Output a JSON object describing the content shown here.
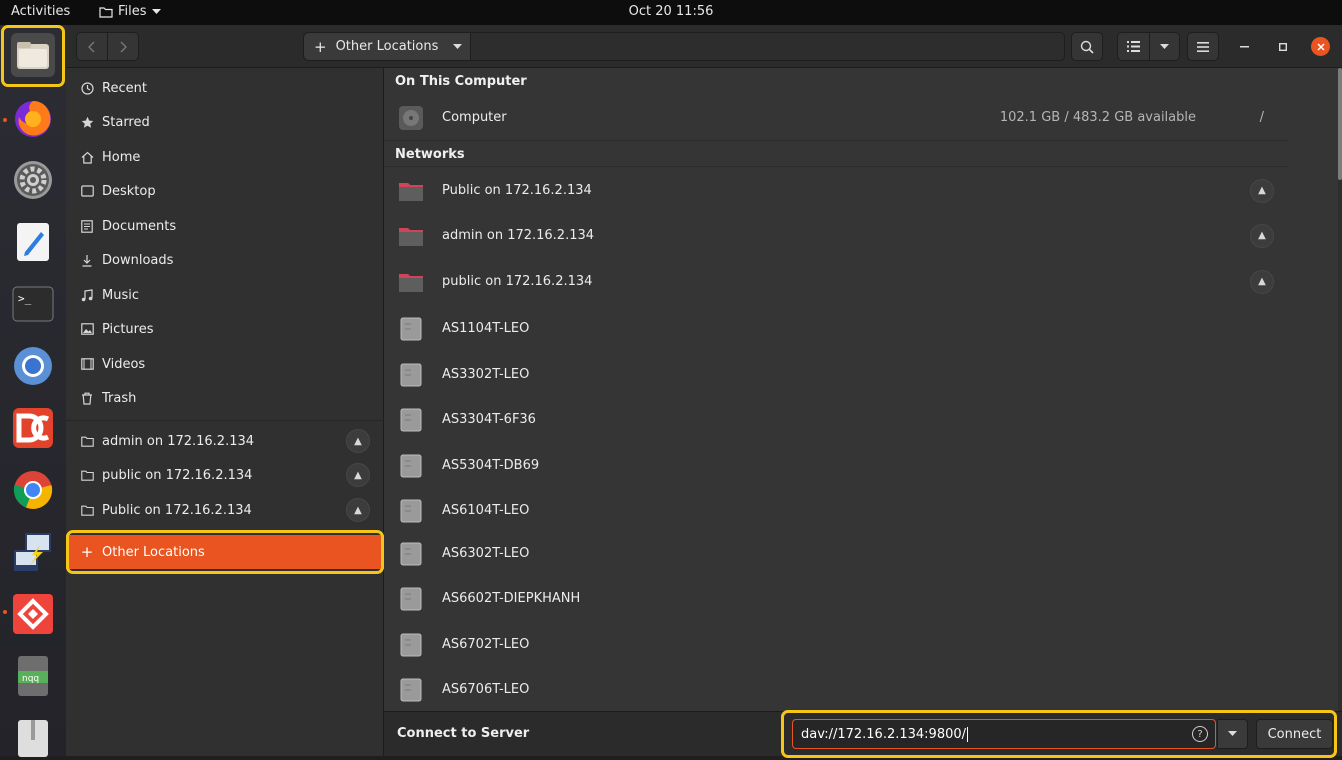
{
  "topbar": {
    "activities": "Activities",
    "app_name": "Files",
    "clock": "Oct 20  11:56"
  },
  "dock": {
    "items": [
      "files-icon",
      "firefox-icon",
      "settings-icon",
      "text-editor-icon",
      "terminal-icon",
      "chromium-icon",
      "doublecommander-icon",
      "chrome-icon",
      "network-connect-icon",
      "anydesk-icon",
      "notes-icon",
      "archive-icon"
    ]
  },
  "header": {
    "location_label": "Other Locations",
    "add_symbol": "+"
  },
  "sidebar": {
    "places": [
      {
        "label": "Recent",
        "icon": "clock-icon"
      },
      {
        "label": "Starred",
        "icon": "star-icon"
      },
      {
        "label": "Home",
        "icon": "home-icon"
      },
      {
        "label": "Desktop",
        "icon": "desktop-icon"
      },
      {
        "label": "Documents",
        "icon": "documents-icon"
      },
      {
        "label": "Downloads",
        "icon": "downloads-icon"
      },
      {
        "label": "Music",
        "icon": "music-icon"
      },
      {
        "label": "Pictures",
        "icon": "pictures-icon"
      },
      {
        "label": "Videos",
        "icon": "videos-icon"
      },
      {
        "label": "Trash",
        "icon": "trash-icon"
      }
    ],
    "mounts": [
      {
        "label": "admin on 172.16.2.134"
      },
      {
        "label": "public on 172.16.2.134"
      },
      {
        "label": "Public on 172.16.2.134"
      }
    ],
    "other_locations": "Other Locations"
  },
  "main": {
    "on_this_computer": "On This Computer",
    "computer": {
      "label": "Computer",
      "info": "102.1 GB / 483.2 GB available",
      "path": "/"
    },
    "networks": "Networks",
    "network_mounts": [
      {
        "label": "Public on 172.16.2.134"
      },
      {
        "label": "admin on 172.16.2.134"
      },
      {
        "label": "public on 172.16.2.134"
      }
    ],
    "network_hosts": [
      {
        "label": "AS1104T-LEO"
      },
      {
        "label": "AS3302T-LEO"
      },
      {
        "label": "AS3304T-6F36"
      },
      {
        "label": "AS5304T-DB69"
      },
      {
        "label": "AS6104T-LEO"
      },
      {
        "label": "AS6302T-LEO"
      },
      {
        "label": "AS6602T-DIEPKHANH"
      },
      {
        "label": "AS6702T-LEO"
      },
      {
        "label": "AS6706T-LEO"
      }
    ]
  },
  "footer": {
    "title": "Connect to Server",
    "server_address": "dav://172.16.2.134:9800/",
    "help_symbol": "?",
    "connect_label": "Connect"
  },
  "colors": {
    "accent": "#e95420",
    "highlight": "#f5c518"
  }
}
